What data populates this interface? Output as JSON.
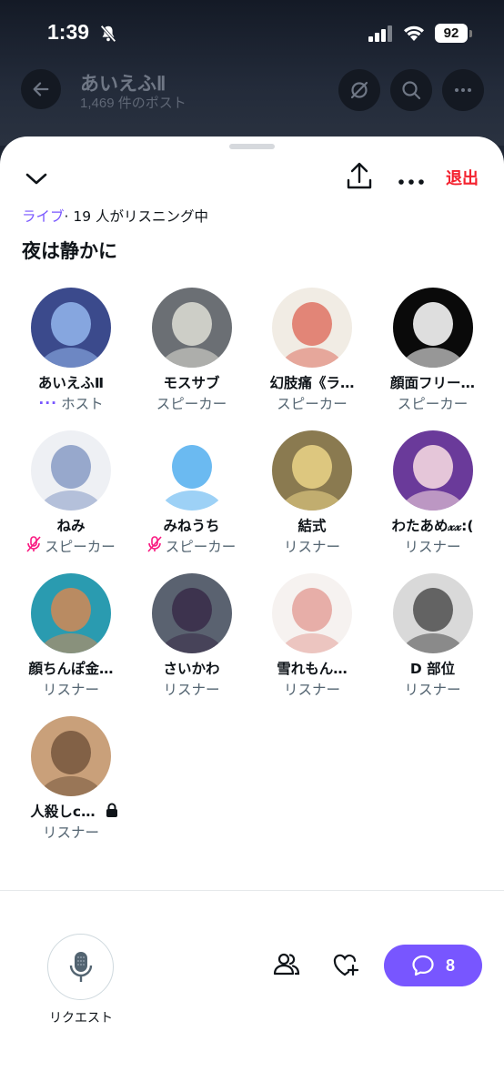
{
  "status_bar": {
    "time": "1:39",
    "battery": "92"
  },
  "header": {
    "title": "あいえふⅡ",
    "subtitle": "1,469 件のポスト"
  },
  "sheet": {
    "leave_label": "退出",
    "live_label": "ライブ",
    "listening_text": "· 19 人がリスニング中",
    "title": "夜は静かに"
  },
  "participants": [
    {
      "name": "あいえふⅡ",
      "role": "ホスト",
      "host_dots": "···",
      "muted": false,
      "avatar_colors": [
        "#3b4a8c",
        "#8fb0e8"
      ]
    },
    {
      "name": "モスサブ",
      "role": "スピーカー",
      "muted": false,
      "avatar_colors": [
        "#6b6f74",
        "#d8d8d0"
      ]
    },
    {
      "name": "幻肢痛《ラ…",
      "role": "スピーカー",
      "muted": false,
      "avatar_colors": [
        "#f1ece4",
        "#e07a6a"
      ]
    },
    {
      "name": "顔面フリー…",
      "role": "スピーカー",
      "muted": false,
      "avatar_colors": [
        "#0a0a0a",
        "#f5f5f5"
      ]
    },
    {
      "name": "ねみ",
      "role": "スピーカー",
      "muted": true,
      "avatar_colors": [
        "#eef0f4",
        "#8da0c8"
      ]
    },
    {
      "name": "みねうち",
      "role": "スピーカー",
      "muted": true,
      "avatar_colors": [
        "#ffffff",
        "#5bb3f0"
      ]
    },
    {
      "name": "結式",
      "role": "リスナー",
      "muted": false,
      "avatar_colors": [
        "#8a7a50",
        "#e6cf84"
      ]
    },
    {
      "name": "わたあめ𝓍𝓍:(",
      "role": "リスナー",
      "muted": false,
      "avatar_colors": [
        "#6a3a9a",
        "#f3d6e0"
      ]
    },
    {
      "name": "顔ちんぽ金…",
      "role": "リスナー",
      "muted": false,
      "avatar_colors": [
        "#2a9bb0",
        "#c98a5a"
      ]
    },
    {
      "name": "さいかわ",
      "role": "リスナー",
      "muted": false,
      "avatar_colors": [
        "#5a6270",
        "#3a2f4a"
      ]
    },
    {
      "name": "雪れもん…",
      "role": "リスナー",
      "muted": false,
      "avatar_colors": [
        "#f6f2f0",
        "#e6a6a0"
      ]
    },
    {
      "name": "D 部位",
      "role": "リスナー",
      "muted": false,
      "avatar_colors": [
        "#d9d9d9",
        "#555555"
      ]
    },
    {
      "name": "人殺しc…",
      "role": "リスナー",
      "muted": false,
      "locked": true,
      "avatar_colors": [
        "#c9a07a",
        "#7a5a40"
      ]
    }
  ],
  "footer": {
    "request_label": "リクエスト",
    "chat_count": "8"
  },
  "colors": {
    "accent": "#7856ff",
    "leave": "#f4212e",
    "muted": "#f91880",
    "secondary_text": "#536471"
  }
}
